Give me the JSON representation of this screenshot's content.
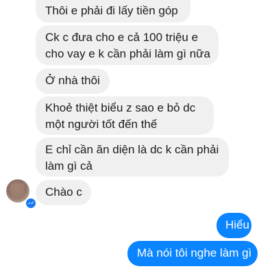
{
  "messages": [
    {
      "text": "Thôi e phải đi lấy tiền góp",
      "from": "other"
    },
    {
      "line1": "Ck c đưa cho e cả 100 triệu e",
      "line2": "cho vay e k cần phải làm gì nữa",
      "from": "other"
    },
    {
      "text": "Ở nhà thôi",
      "from": "other"
    },
    {
      "line1": "Khoẻ thiệt biểu z sao e bỏ dc",
      "line2": "một người tốt đến thế",
      "from": "other"
    },
    {
      "line1": "E chỉ cần ăn diện là dc k cần phải",
      "line2": "làm gì cả",
      "from": "other"
    },
    {
      "text": "Chào c",
      "from": "other"
    },
    {
      "text": "Hiểu",
      "from": "me"
    },
    {
      "text": "Mà nói tôi nghe làm gì",
      "from": "me"
    }
  ],
  "colors": {
    "incoming": "#f1f0f0",
    "outgoing": "#0a84ff",
    "badge": "#1877f2"
  },
  "icons": {
    "avatar": "contact-avatar",
    "badge": "messenger-badge-icon"
  }
}
